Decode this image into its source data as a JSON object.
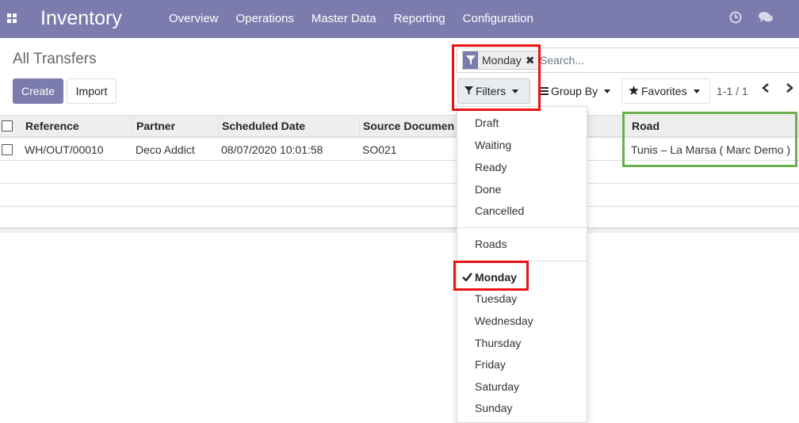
{
  "topbar": {
    "app_title": "Inventory",
    "menu": [
      "Overview",
      "Operations",
      "Master Data",
      "Reporting",
      "Configuration"
    ],
    "icons": [
      "apps-grid-icon",
      "clock-icon",
      "chat-icon"
    ],
    "color": "#7c7bad"
  },
  "control": {
    "breadcrumb": "All Transfers",
    "create_label": "Create",
    "import_label": "Import",
    "search": {
      "facet_label": "Monday",
      "facet_close": "✖",
      "placeholder": "Search..."
    },
    "filters_label": "Filters",
    "groupby_label": "Group By",
    "favorites_label": "Favorites",
    "pager": "1-1 / 1"
  },
  "table": {
    "columns": [
      "Reference",
      "Partner",
      "Scheduled Date",
      "Source Documen",
      "Road"
    ],
    "rows": [
      {
        "reference": "WH/OUT/00010",
        "partner": "Deco Addict",
        "scheduled_date": "08/07/2020 10:01:58",
        "source": "SO021",
        "road": "Tunis – La Marsa ( Marc Demo )"
      }
    ]
  },
  "filters_dropdown": {
    "group1": [
      "Draft",
      "Waiting",
      "Ready",
      "Done",
      "Cancelled"
    ],
    "group2": [
      "Roads"
    ],
    "days": [
      "Monday",
      "Tuesday",
      "Wednesday",
      "Thursday",
      "Friday",
      "Saturday",
      "Sunday"
    ],
    "active": "Monday"
  },
  "annotation_colors": {
    "red": "#e81312",
    "green": "#6ab04c"
  }
}
